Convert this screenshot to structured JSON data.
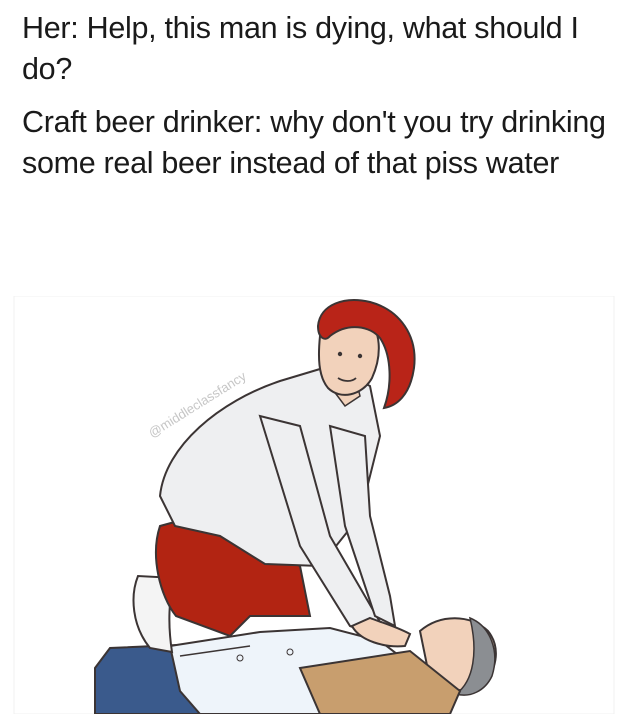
{
  "caption": {
    "line1": "Her: Help, this man is dying, what should I do?",
    "line2": "Craft beer drinker: why don't you try drinking some real beer instead of that piss water"
  },
  "illustration": {
    "watermark": "@middleclassfancy",
    "description_icon": "cpr-illustration",
    "colors": {
      "hair": "#b92418",
      "pants": "#b22412",
      "shirt": "#eeeff1",
      "skin": "#f2d2bb",
      "victim_pants": "#3a5a8c",
      "victim_hair": "#8b8e92",
      "outline": "#3b3434"
    }
  }
}
